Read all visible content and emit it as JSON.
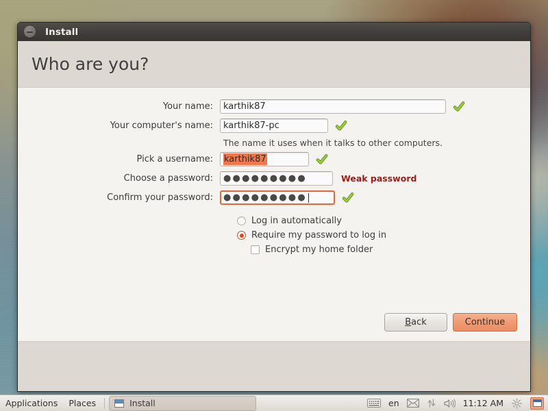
{
  "window": {
    "title": "Install",
    "minimize_icon": "minimize-icon"
  },
  "page": {
    "heading": "Who are you?"
  },
  "form": {
    "fields": [
      {
        "label": "Your name:",
        "value": "karthik87",
        "placeholder": "",
        "status_icon": "green-check-icon",
        "state": "valid"
      },
      {
        "label": "Your computer's name:",
        "value": "karthik87-pc",
        "placeholder": "",
        "status_icon": "green-check-icon",
        "state": "valid",
        "hint": "The name it uses when it talks to other computers."
      },
      {
        "label": "Pick a username:",
        "value": "karthik87",
        "placeholder": "",
        "status_icon": "green-check-icon",
        "state": "selected"
      },
      {
        "label": "Choose a password:",
        "value": "●●●●●●●●●",
        "placeholder": "",
        "status_text": "Weak password",
        "state": "weak"
      },
      {
        "label": "Confirm your password:",
        "value": "●●●●●●●●●",
        "placeholder": "",
        "status_icon": "green-check-icon",
        "state": "focused"
      }
    ],
    "options": {
      "login_auto": {
        "label": "Log in automatically",
        "selected": false
      },
      "require_password": {
        "label": "Require my password to log in",
        "selected": true
      },
      "encrypt_home": {
        "label": "Encrypt my home folder",
        "checked": false
      }
    }
  },
  "buttons": {
    "back": "Back",
    "back_mnemonic": "B",
    "back_rest": "ack",
    "continue": "Continue"
  },
  "panel": {
    "applications": "Applications",
    "places": "Places",
    "task_install": "Install",
    "tray": {
      "keyboard_icon": "keyboard-icon",
      "language": "en",
      "mail_icon": "envelope-icon",
      "network_icon": "network-arrows-icon",
      "volume_icon": "speaker-icon",
      "clock": "11:12 AM",
      "settings_icon": "gear-icon",
      "window_icon": "window-icon"
    }
  },
  "colors": {
    "accent_orange": "#dd4814",
    "selection_orange": "#f2764b",
    "focus_border": "#e0683a",
    "warning_red": "#9e1b17",
    "check_green": "#8ec641",
    "header_band": "#ded8d2",
    "content_bg": "#f4f3f0",
    "titlebar": "#403d3a"
  }
}
